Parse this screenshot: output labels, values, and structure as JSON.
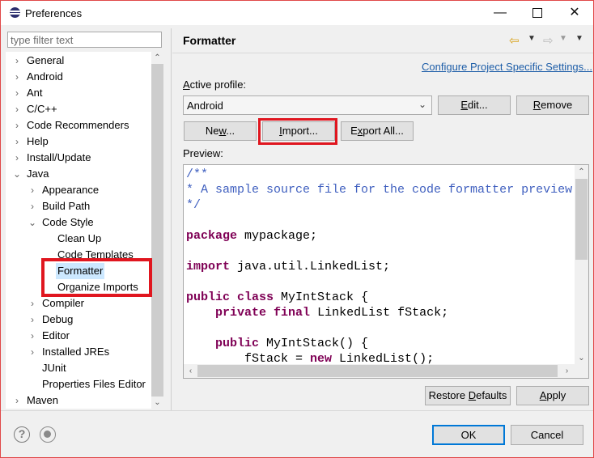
{
  "window": {
    "title": "Preferences",
    "minimize": "—",
    "close": "✕"
  },
  "sidebar": {
    "filter_placeholder": "type filter text",
    "tree": [
      {
        "label": "General",
        "expanded": false
      },
      {
        "label": "Android",
        "expanded": false
      },
      {
        "label": "Ant",
        "expanded": false
      },
      {
        "label": "C/C++",
        "expanded": false
      },
      {
        "label": "Code Recommenders",
        "expanded": false
      },
      {
        "label": "Help",
        "expanded": false
      },
      {
        "label": "Install/Update",
        "expanded": false
      },
      {
        "label": "Java",
        "expanded": true
      },
      {
        "label": "Appearance",
        "expanded": false
      },
      {
        "label": "Build Path",
        "expanded": false
      },
      {
        "label": "Code Style",
        "expanded": true
      },
      {
        "label": "Clean Up"
      },
      {
        "label": "Code Templates"
      },
      {
        "label": "Formatter",
        "selected": true
      },
      {
        "label": "Organize Imports"
      },
      {
        "label": "Compiler",
        "expanded": false
      },
      {
        "label": "Debug",
        "expanded": false
      },
      {
        "label": "Editor",
        "expanded": false
      },
      {
        "label": "Installed JREs",
        "expanded": false
      },
      {
        "label": "JUnit"
      },
      {
        "label": "Properties Files Editor"
      },
      {
        "label": "Maven",
        "expanded": false
      }
    ]
  },
  "page": {
    "title": "Formatter",
    "configure_link": "Configure Project Specific Settings...",
    "active_profile_label": "Active profile:",
    "active_profile_value": "Android",
    "edit_button": {
      "pre": "",
      "mn": "E",
      "post": "dit..."
    },
    "remove_button": {
      "pre": "",
      "mn": "R",
      "post": "emove"
    },
    "new_button": {
      "pre": "Ne",
      "mn": "w",
      "post": "..."
    },
    "import_button": {
      "pre": "",
      "mn": "I",
      "post": "mport..."
    },
    "export_button": {
      "pre": "E",
      "mn": "x",
      "post": "port All..."
    },
    "preview_label": "Preview:",
    "restore_defaults_button": {
      "pre": "Restore ",
      "mn": "D",
      "post": "efaults"
    },
    "apply_button": {
      "pre": "",
      "mn": "A",
      "post": "pply"
    }
  },
  "preview_code": [
    {
      "parts": [
        {
          "t": "/**",
          "c": "cm"
        }
      ]
    },
    {
      "parts": [
        {
          "t": "* A sample source file for the code formatter preview",
          "c": "cm"
        }
      ]
    },
    {
      "parts": [
        {
          "t": "*/",
          "c": "cm"
        }
      ]
    },
    {
      "parts": []
    },
    {
      "parts": [
        {
          "t": "package",
          "c": "kw"
        },
        {
          "t": " mypackage;",
          "c": ""
        }
      ]
    },
    {
      "parts": []
    },
    {
      "parts": [
        {
          "t": "import",
          "c": "kw"
        },
        {
          "t": " java.util.LinkedList;",
          "c": ""
        }
      ]
    },
    {
      "parts": []
    },
    {
      "parts": [
        {
          "t": "public",
          "c": "kw"
        },
        {
          "t": " ",
          "c": ""
        },
        {
          "t": "class",
          "c": "kw"
        },
        {
          "t": " MyIntStack {",
          "c": ""
        }
      ]
    },
    {
      "parts": [
        {
          "t": "    ",
          "c": ""
        },
        {
          "t": "private",
          "c": "kw"
        },
        {
          "t": " ",
          "c": ""
        },
        {
          "t": "final",
          "c": "kw"
        },
        {
          "t": " LinkedList fStack;",
          "c": ""
        }
      ]
    },
    {
      "parts": []
    },
    {
      "parts": [
        {
          "t": "    ",
          "c": ""
        },
        {
          "t": "public",
          "c": "kw"
        },
        {
          "t": " MyIntStack() {",
          "c": ""
        }
      ]
    },
    {
      "parts": [
        {
          "t": "        fStack = ",
          "c": ""
        },
        {
          "t": "new",
          "c": "kw"
        },
        {
          "t": " LinkedList();",
          "c": ""
        }
      ]
    }
  ],
  "footer": {
    "ok_button": "OK",
    "cancel_button": "Cancel"
  },
  "colors": {
    "keyword": "#7f0055",
    "comment": "#3f5fbf",
    "link": "#1e5ea8",
    "highlight_box": "#e0161f",
    "selection": "#cce8ff"
  },
  "icons": {
    "app": "eclipse-icon",
    "back": "back-arrow-icon",
    "forward": "forward-arrow-icon",
    "help": "help-icon",
    "record": "record-macro-icon"
  }
}
